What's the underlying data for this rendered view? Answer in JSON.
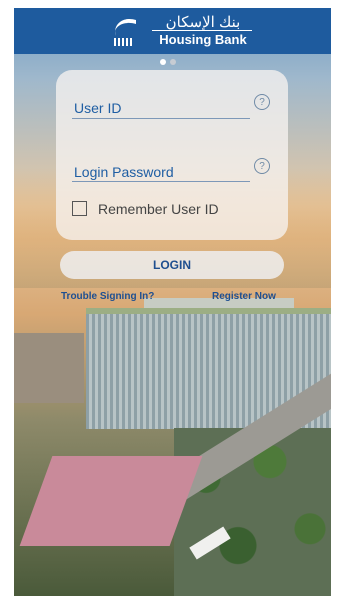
{
  "header": {
    "brand_arabic": "بنك الإسكان",
    "brand_english": "Housing Bank"
  },
  "pager": {
    "count": 2,
    "active_index": 0
  },
  "login_form": {
    "user_id_label": "User ID",
    "password_label": "Login Password",
    "help_icon_glyph": "?",
    "remember_label": "Remember User ID",
    "remember_checked": false
  },
  "actions": {
    "login_label": "LOGIN",
    "trouble_label": "Trouble Signing In?",
    "register_label": "Register Now"
  },
  "icons": {
    "logo": "housing-bank-logo",
    "help": "question-circle-icon"
  },
  "colors": {
    "header_bg": "#1e5b9e",
    "label_blue": "#1f5ea3",
    "link_blue": "#1e4f91"
  }
}
